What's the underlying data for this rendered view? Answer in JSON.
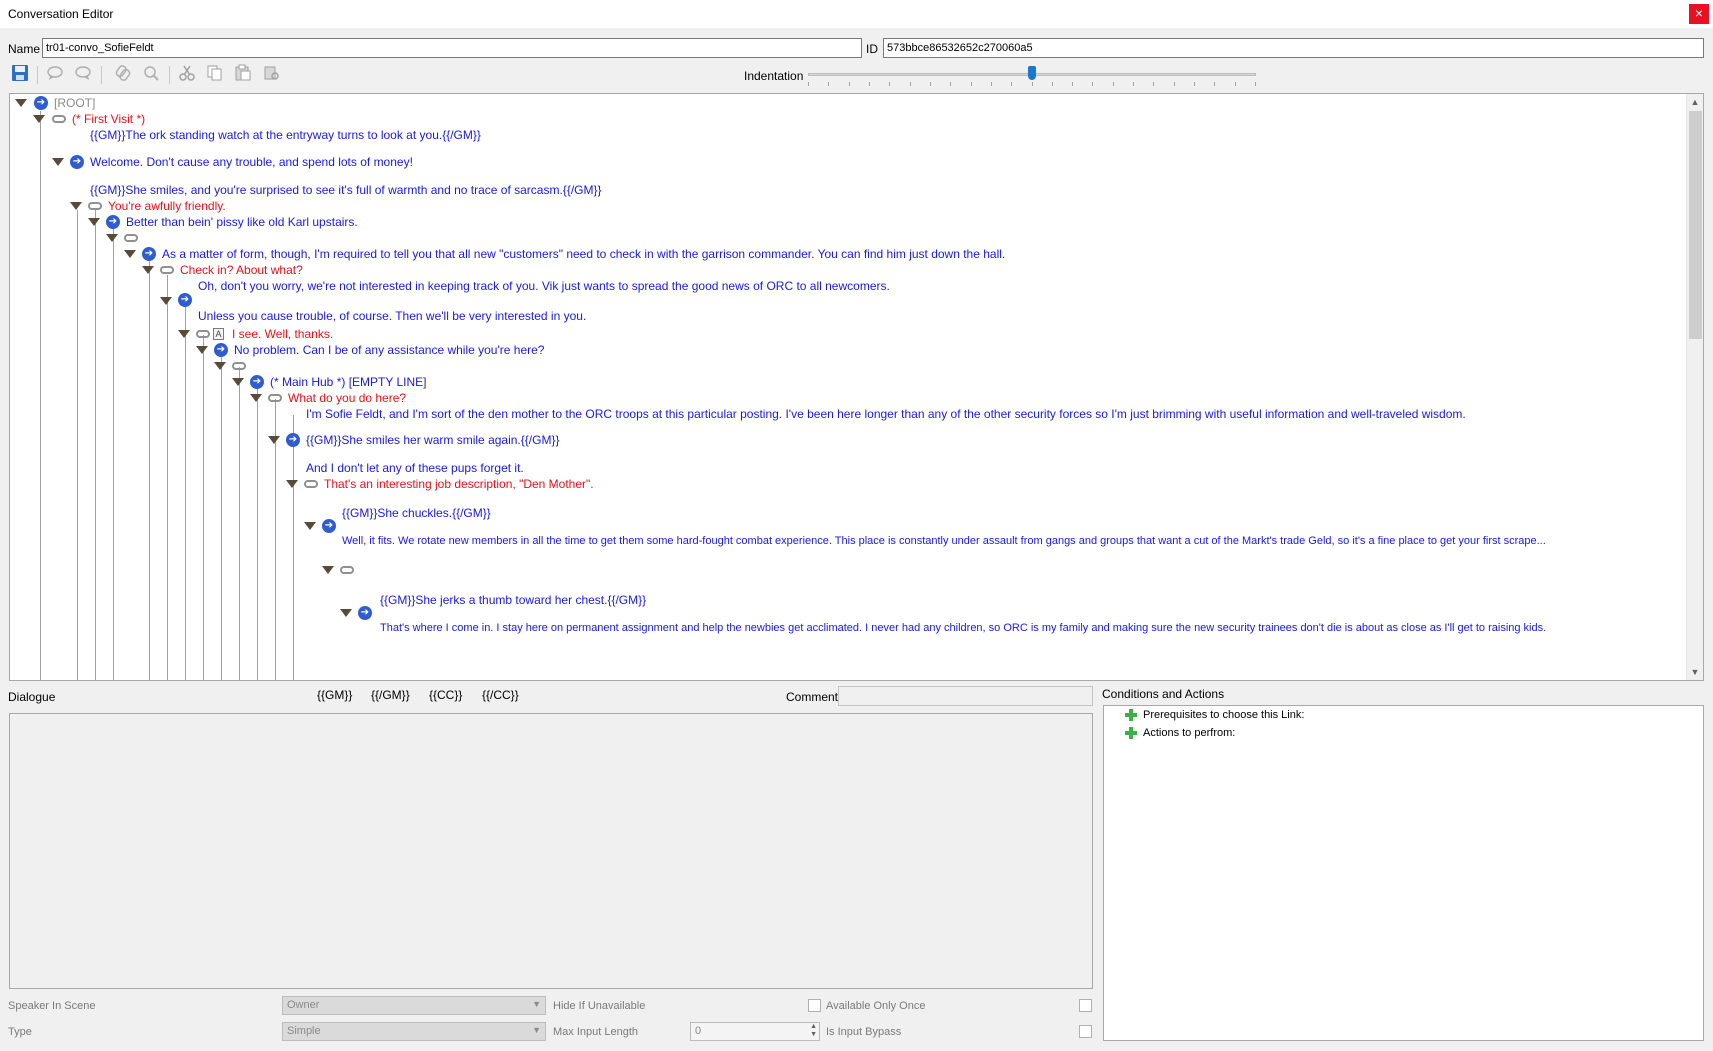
{
  "window": {
    "title": "Conversation Editor",
    "close": "×"
  },
  "header": {
    "name_label": "Name",
    "name_value": "tr01-convo_SofieFeldt",
    "id_label": "ID",
    "id_value": "573bbce86532652c270060a5"
  },
  "toolbar": {
    "buttons": [
      "save-icon",
      "add-node-icon",
      "add-sibling-icon",
      "link-icon",
      "unlink-icon",
      "cut-icon",
      "copy-icon",
      "paste-icon",
      "paste-link-icon"
    ],
    "indentation_label": "Indentation",
    "indentation_level": 0.5
  },
  "tree": {
    "root": "[ROOT]",
    "first_visit": "(* First Visit *)",
    "n1": "{{GM}}The ork standing watch at the entryway turns to look at you.{{/GM}}",
    "n2": "Welcome. Don't cause any trouble, and spend lots of money!",
    "n3": "{{GM}}She smiles, and you're surprised to see it's full of warmth and no trace of sarcasm.{{/GM}}",
    "r1": "You're awfully friendly.",
    "n4": "Better than bein' pissy like old Karl upstairs.",
    "n5": "As a matter of form, though, I'm required to tell you that all new \"customers\" need to check in with the garrison commander. You can find him just down the hall.",
    "r2": "Check in? About what?",
    "n6": "Oh, don't you worry, we're not interested in keeping track of you. Vik just wants to spread the good news of ORC to all newcomers.",
    "n7": "Unless you cause trouble, of course. Then we'll be very interested in you.",
    "r3": "I see. Well, thanks.",
    "a_icon": "A",
    "n8": "No problem. Can I be of any assistance while you're here?",
    "n9": "(* Main Hub *) [EMPTY LINE]",
    "r4": "What do you do here?",
    "n10": "I'm Sofie Feldt, and I'm sort of the den mother to the ORC troops at this particular posting. I've been here longer than any of the other security forces so I'm just brimming with useful information and well-traveled wisdom.",
    "n11": "{{GM}}She smiles her warm smile again.{{/GM}}",
    "n12": "And I don't let any of these pups forget it.",
    "r5": "That's an interesting job description, \"Den Mother\".",
    "n13": "{{GM}}She chuckles.{{/GM}}",
    "n14": "Well, it fits. We rotate new members in all the time to get them some hard-fought combat experience. This place is constantly under assault from gangs and groups that want a cut of the Markt's trade Geld, so it's a fine place to get your first scrape...",
    "n15": "{{GM}}She jerks a thumb toward her chest.{{/GM}}",
    "n16": "That's where I come in. I stay here on permanent assignment and help the newbies get acclimated. I never had any children, so ORC is my family and making sure the new security trainees don't die is about as close as I'll get to raising kids."
  },
  "dialogue": {
    "label": "Dialogue",
    "tags": [
      "{{GM}}",
      "{{/GM}}",
      "{{CC}}",
      "{{/CC}}"
    ],
    "comment_label": "Comment",
    "comment_value": ""
  },
  "conditions": {
    "title": "Conditions and Actions",
    "items": [
      "Prerequisites to choose this Link:",
      "Actions to perfrom:"
    ]
  },
  "props": {
    "speaker_label": "Speaker In Scene",
    "speaker_value": "Owner",
    "type_label": "Type",
    "type_value": "Simple",
    "hide_label": "Hide If Unavailable",
    "max_input_label": "Max Input Length",
    "max_input_value": "0",
    "available_once_label": "Available Only Once",
    "input_bypass_label": "Is Input Bypass"
  }
}
